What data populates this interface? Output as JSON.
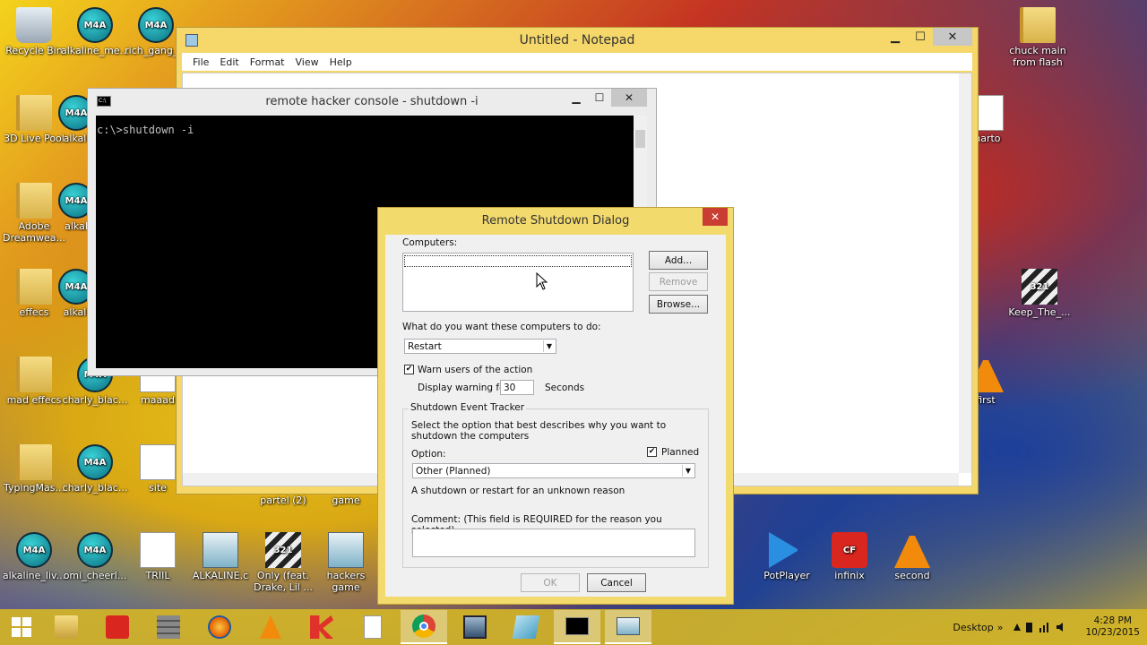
{
  "desktop": {
    "icons": [
      {
        "label": "Recycle Bin",
        "glyph": "",
        "kind": "bin"
      },
      {
        "label": "alkaline_me...",
        "glyph": "M4A",
        "kind": "m4a"
      },
      {
        "label": "rich_gang_...",
        "glyph": "M4A",
        "kind": "m4a"
      },
      {
        "label": "3D Live Pool",
        "glyph": "",
        "kind": "folder"
      },
      {
        "label": "alkali",
        "glyph": "M4A",
        "kind": "m4a"
      },
      {
        "label": "Adobe Dreamwea...",
        "glyph": "",
        "kind": "folder"
      },
      {
        "label": "alkal",
        "glyph": "M4A",
        "kind": "m4a"
      },
      {
        "label": "effecs",
        "glyph": "",
        "kind": "folder"
      },
      {
        "label": "alkali",
        "glyph": "M4A",
        "kind": "m4a"
      },
      {
        "label": "mad effecs",
        "glyph": "",
        "kind": "folder"
      },
      {
        "label": "charly_blac...",
        "glyph": "M4A",
        "kind": "m4a"
      },
      {
        "label": "maaad",
        "glyph": "",
        "kind": "doc"
      },
      {
        "label": "TypingMas...",
        "glyph": "",
        "kind": "folder"
      },
      {
        "label": "charly_blac...",
        "glyph": "M4A",
        "kind": "m4a"
      },
      {
        "label": "site",
        "glyph": "",
        "kind": "doc"
      },
      {
        "label": "alkaline_liv...",
        "glyph": "M4A",
        "kind": "m4a"
      },
      {
        "label": "omi_cheerl...",
        "glyph": "M4A",
        "kind": "m4a"
      },
      {
        "label": "TRIIL",
        "glyph": "",
        "kind": "doc"
      },
      {
        "label": "ALKALINE.c",
        "glyph": "",
        "kind": "img"
      },
      {
        "label": "Only (feat. Drake, Lil ...",
        "glyph": "321",
        "kind": "clap"
      },
      {
        "label": "hackers game",
        "glyph": "",
        "kind": "img"
      },
      {
        "label": "chuck main from flash",
        "glyph": "",
        "kind": "folder"
      },
      {
        "label": "marto",
        "glyph": "",
        "kind": "doc"
      },
      {
        "label": "Keep_The_...",
        "glyph": "321",
        "kind": "clap"
      },
      {
        "label": "first",
        "glyph": "",
        "kind": "vlc"
      },
      {
        "label": "PotPlayer",
        "glyph": "",
        "kind": "pot"
      },
      {
        "label": "infinix",
        "glyph": "CF",
        "kind": "cf"
      },
      {
        "label": "second",
        "glyph": "",
        "kind": "vlc"
      },
      {
        "label": "partel (2)",
        "glyph": "",
        "kind": "none"
      },
      {
        "label": "game",
        "glyph": "",
        "kind": "none"
      }
    ]
  },
  "notepad": {
    "title": "Untitled - Notepad",
    "menu": [
      "File",
      "Edit",
      "Format",
      "View",
      "Help"
    ],
    "min": "▁",
    "max": "☐",
    "close": "✕"
  },
  "console": {
    "title": "remote hacker console - shutdown  -i",
    "icon_text": "C:\\",
    "line1": "c:\\>shutdown -i",
    "min": "▁",
    "max": "☐",
    "close": "✕"
  },
  "dialog": {
    "title": "Remote Shutdown Dialog",
    "close": "✕",
    "computers_label": "Computers:",
    "add": "Add...",
    "remove": "Remove",
    "browse": "Browse...",
    "action_label": "What do you want these computers to do:",
    "action_value": "Restart",
    "warn_label": "Warn users of the action",
    "warn_checked": "✔",
    "display_warning_label": "Display warning for",
    "display_warning_value": "30",
    "seconds_label": "Seconds",
    "tracker_legend": "Shutdown Event Tracker",
    "tracker_desc": "Select the option that best describes why you want to shutdown the computers",
    "option_label": "Option:",
    "planned_label": "Planned",
    "planned_checked": "✔",
    "option_value": "Other (Planned)",
    "reason_desc": "A shutdown or restart for an unknown reason",
    "comment_label": "Comment:  (This field is REQUIRED for the reason you selected)",
    "ok": "OK",
    "cancel": "Cancel",
    "dropdown_arrow": "▼"
  },
  "taskbar": {
    "desktop_label": "Desktop",
    "chevron": "»",
    "time": "4:28 PM",
    "date": "10/23/2015",
    "apps": [
      "file-explorer-icon",
      "cf-icon",
      "wall-icon",
      "firefox-icon",
      "vlc-icon",
      "kaspersky-icon",
      "document-icon",
      "chrome-icon",
      "movie-maker-icon",
      "paint-icon",
      "cmd-icon",
      "shutdown-dialog-icon"
    ]
  }
}
